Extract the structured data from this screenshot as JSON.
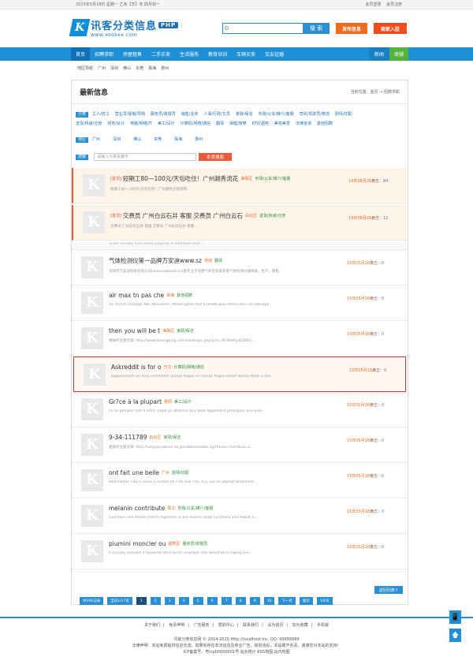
{
  "topbar": {
    "date": "2015年5月18日 星期一 乙未【羊】年 四月初一",
    "login": "会员登录",
    "register": "会员注册"
  },
  "logo": {
    "name": "讯客分类信息",
    "badge": "PHP",
    "url": "www.xookee.com"
  },
  "search": {
    "placeholder": "",
    "button": "搜 索"
  },
  "header_buttons": {
    "post": "发布信息",
    "biz": "商家入驻"
  },
  "nav": {
    "items": [
      "首页",
      "招聘求职",
      "房屋租售",
      "二手买卖",
      "生活服务",
      "教育培训",
      "车辆买卖",
      "交友征婚"
    ],
    "news": "新闻",
    "shop": "商铺"
  },
  "subnav": {
    "items": [
      "地区导航",
      "广州",
      "深圳",
      "佛山",
      "东莞",
      "珠海",
      "惠州"
    ]
  },
  "main": {
    "title": "最新信息",
    "crumb": "当前位置：首页 → 招聘求职"
  },
  "filters": {
    "category_tag": "分类",
    "categories_row1": [
      "工人/技工",
      "营业员/促销/导购",
      "服务员/收银员",
      "销售/业务",
      "人事/行政/文员",
      "家政/保洁",
      "市场/公关/媒介/客服",
      "司机/驾驶员/物流",
      "厨师/切配"
    ],
    "categories_row2": [
      "送货/快递/仓管",
      "财务/会计",
      "电脑/网络/IT",
      "美工/设计",
      "计算机/网络/通信",
      "翻译",
      "保健/按摩",
      "KTV/酒吧",
      "美容美发",
      "法律咨询",
      "其他招聘"
    ],
    "area_tag": "地区",
    "areas": [
      "广州",
      "深圳",
      "佛山",
      "东莞",
      "珠海",
      "惠州"
    ],
    "search_tag": "搜索",
    "search_placeholder": "请输入分类关键字",
    "search_button": "本类搜索"
  },
  "listings": [
    {
      "pin": "[置顶]",
      "title": "短期工80—100元/天包吃住！广州越秀流花",
      "city": "海珠区",
      "cat": "市场/公关/媒介/客服",
      "desc": "短期工80—100元/天包吃住！广州越秀流花招聘...",
      "date": "14年08月28日",
      "clicks": "点击：84"
    },
    {
      "pin": "[置顶]",
      "title": "交费员 广州白云石井 客服 交费员 广州白云石",
      "city": "白云区",
      "cat": "送货/快递/仓管",
      "desc": "交费员 广州白云石井 客服 交费员 广州白云石井 客服...",
      "date": "14年08月28日",
      "clicks": "点击：12"
    },
    {
      "title": "气体检测仪第一品牌万安迪www.sz",
      "city": "增城",
      "cat": "翻译",
      "desc": "深圳市万安迪科技有限公司(www.szwandi.cn)是专业于可燃气体及有毒有害气体检测仪器研发、生产、销售、服务于一体的高新技术公司。公司致力于气体...",
      "date": "15年05月18日",
      "clicks": "点击：0"
    },
    {
      "title": "air max tn pas che",
      "city": "珠海",
      "cat": "其他招聘",
      "desc": "Un récent sondage ABC Nouvelles / Washington Post a révélé que même dans les ménage...",
      "date": "15年05月18日",
      "clicks": "点击：0"
    },
    {
      "title": "then you will be t",
      "city": "海珠区",
      "cat": "家政/保洁",
      "desc": "相关的主题文章: http://www.baxingbing.com/viewtopic.php?pid=46340#p463461...",
      "date": "15年05月18日",
      "clicks": "点击：0"
    },
    {
      "title": "Askreddit is for o",
      "city": "万江",
      "cat": "计算机/网络/通信",
      "desc": "bigbehemoth air max comments scarpe hogan en scarpe hogan outlet donna What is the...",
      "date": "15年05月18日",
      "clicks": "点击：0"
    },
    {
      "title": "Gr?ce à la plupart",
      "city": "惠阳",
      "cat": "美工/设计",
      "desc": "ce ne pompes font à votre corps La vitamine B12 peut également provoquer une anxi...",
      "date": "15年05月18日",
      "clicks": "点击：0"
    },
    {
      "title": "9-34-111789",
      "city": "白云区",
      "cat": "家政/保洁",
      "desc": "相关的主题文章: http://sutyajq.sakura.ne.jp/cabbs/sunbbs.cgi?mode=form&no=1...",
      "date": "15年05月18日",
      "clicks": "点击：0"
    },
    {
      "title": "ont fait une belle",
      "city": "广州",
      "cat": "厨师/切配",
      "desc": "Manchester City a réussi à mettre de c?té Hull City, 4-2, sur un objectif brillamme...",
      "date": "15年05月18日",
      "clicks": "点击：0"
    },
    {
      "title": "melanin contribute",
      "city": "珠江",
      "cat": "市场/公关/媒介/客服",
      "desc": "Functions and Health Effects Pigments in the Human Body Functions and Health E...",
      "date": "15年05月18日",
      "clicks": "点击：0"
    },
    {
      "title": "piumini moncler ou",
      "city": "越秀区",
      "cat": "服务员/收银员",
      "desc": "If socially includes a favourite third So for example, this would be a rowing eve...",
      "date": "15年05月18日",
      "clicks": "点击：0"
    }
  ],
  "partial_row": "Enter socially have been properly in definition both ...",
  "backtop": "返回列表↑",
  "pager": {
    "total": "共166记录",
    "page_of": "当前1/17页",
    "pages": [
      "1",
      "2",
      "3",
      "4",
      "5",
      "6",
      "7",
      "8",
      "9",
      "10"
    ],
    "next": "下一页",
    "last": "尾页",
    "tail": "10/页"
  },
  "footer": {
    "links": [
      "关于我们",
      "免责申明",
      "广告服务",
      "帮助中心",
      "联系我们",
      "设为首页",
      "加为收藏",
      "手机版"
    ],
    "copyright": "讯客分类信息网 © 2014-2020 Http://localhost Inc. QQ: 99999999",
    "notice": "法律声明：本站免费提供信息交流，如果有存在非法信息及商业广告，如有违反，本站概不负责。谢谢您对本站的支持！",
    "icp": "ICP备案号：粤icp00000001号  站长统计  RSS地图  站内地图"
  },
  "side": {
    "mobile": "📱",
    "up": "🡅"
  }
}
